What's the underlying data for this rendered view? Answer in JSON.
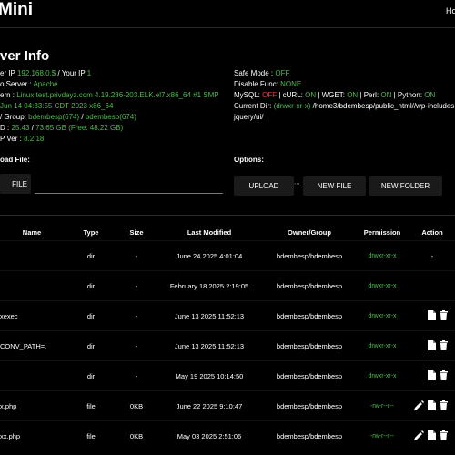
{
  "brand": "Mini",
  "topright": "Ho",
  "server_info": {
    "heading": "ver Info",
    "left": [
      {
        "label": "er IP ",
        "value": "192.168.0.$",
        "sep": " / Your IP ",
        "value2": "1"
      },
      {
        "label": "o Server : ",
        "value": "Apache"
      },
      {
        "label": "ern : ",
        "value": "Linux test.privdayz.com 4.19.286-203.ELK.el7.x86_64 #1 SMP"
      },
      {
        "label": "",
        "value": "Jun 14 04:33:55 CDT 2023 x86_64"
      },
      {
        "label": "/ Group: ",
        "value": "bdembesp(674)",
        "sep": " / ",
        "value2": "bdembesp(674)"
      },
      {
        "label": "D : ",
        "value": "25.43",
        "sep": " / ",
        "value2": "73.65 GB",
        "extra": " (Free: 48.22 GB)"
      },
      {
        "label": "P Ver : ",
        "value": "8.2.18"
      }
    ],
    "safe_mode_label": "Safe Mode : ",
    "safe_mode_value": "OFF",
    "disable_func_label": "Disable Func: ",
    "disable_func_value": "NONE",
    "mysql_label": "MySQL: ",
    "mysql_value": "OFF",
    "curl_label": " | cURL: ",
    "curl_value": "ON",
    "wget_label": " | WGET: ",
    "wget_value": "ON",
    "perl_label": " | Perl: ",
    "perl_value": "ON",
    "python_label": " | Python: ",
    "python_value": "ON",
    "curdir_label": "Current Dir: ",
    "curdir_perm": "(drwxr-xr-x)",
    "curdir_path": " /home3/bdembesp/public_html//wp-includes",
    "curdir_path2": "jquery/ui/"
  },
  "upload": {
    "label": "oad File:",
    "file_button": "FILE"
  },
  "options": {
    "label": "Options:",
    "upload": "UPLOAD",
    "sep": ":::",
    "new_file": "NEW FILE",
    "new_folder": "NEW FOLDER"
  },
  "table": {
    "headers": [
      "Name",
      "Type",
      "Size",
      "Last Modified",
      "Owner/Group",
      "Permission",
      "Action"
    ],
    "rows": [
      {
        "name": "",
        "type": "dir",
        "size": "-",
        "modified": "June 24 2025 4:01:04",
        "owner": "bdembesp/bdembesp",
        "perm": "drwxr-xr-x",
        "action": "-"
      },
      {
        "name": "",
        "type": "dir",
        "size": "-",
        "modified": "February 18 2025 2:19:05",
        "owner": "bdembesp/bdembesp",
        "perm": "drwxr-xr-x",
        "action": ""
      },
      {
        "name": "xexec",
        "type": "dir",
        "size": "-",
        "modified": "June 13 2025 11:52:13",
        "owner": "bdembesp/bdembesp",
        "perm": "drwxr-xr-x",
        "action": "icons"
      },
      {
        "name": "CONV_PATH=.",
        "type": "dir",
        "size": "-",
        "modified": "June 13 2025 11:52:13",
        "owner": "bdembesp/bdembesp",
        "perm": "drwxr-xr-x",
        "action": "icons"
      },
      {
        "name": "",
        "type": "dir",
        "size": "-",
        "modified": "May 19 2025 10:14:50",
        "owner": "bdembesp/bdembesp",
        "perm": "drwxr-xr-x",
        "action": "icons"
      },
      {
        "name": "x.php",
        "type": "file",
        "size": "0KB",
        "modified": "June 22 2025 9:10:47",
        "owner": "bdembesp/bdembesp",
        "perm": "-rw-r--r--",
        "action": "icons3"
      },
      {
        "name": "xx.php",
        "type": "file",
        "size": "0KB",
        "modified": "May 03 2025 2:51:06",
        "owner": "bdembesp/bdembesp",
        "perm": "-rw-r--r--",
        "action": "icons3"
      }
    ]
  },
  "colors": {
    "accent": "#4dbb4d",
    "off": "#e23a3a"
  }
}
